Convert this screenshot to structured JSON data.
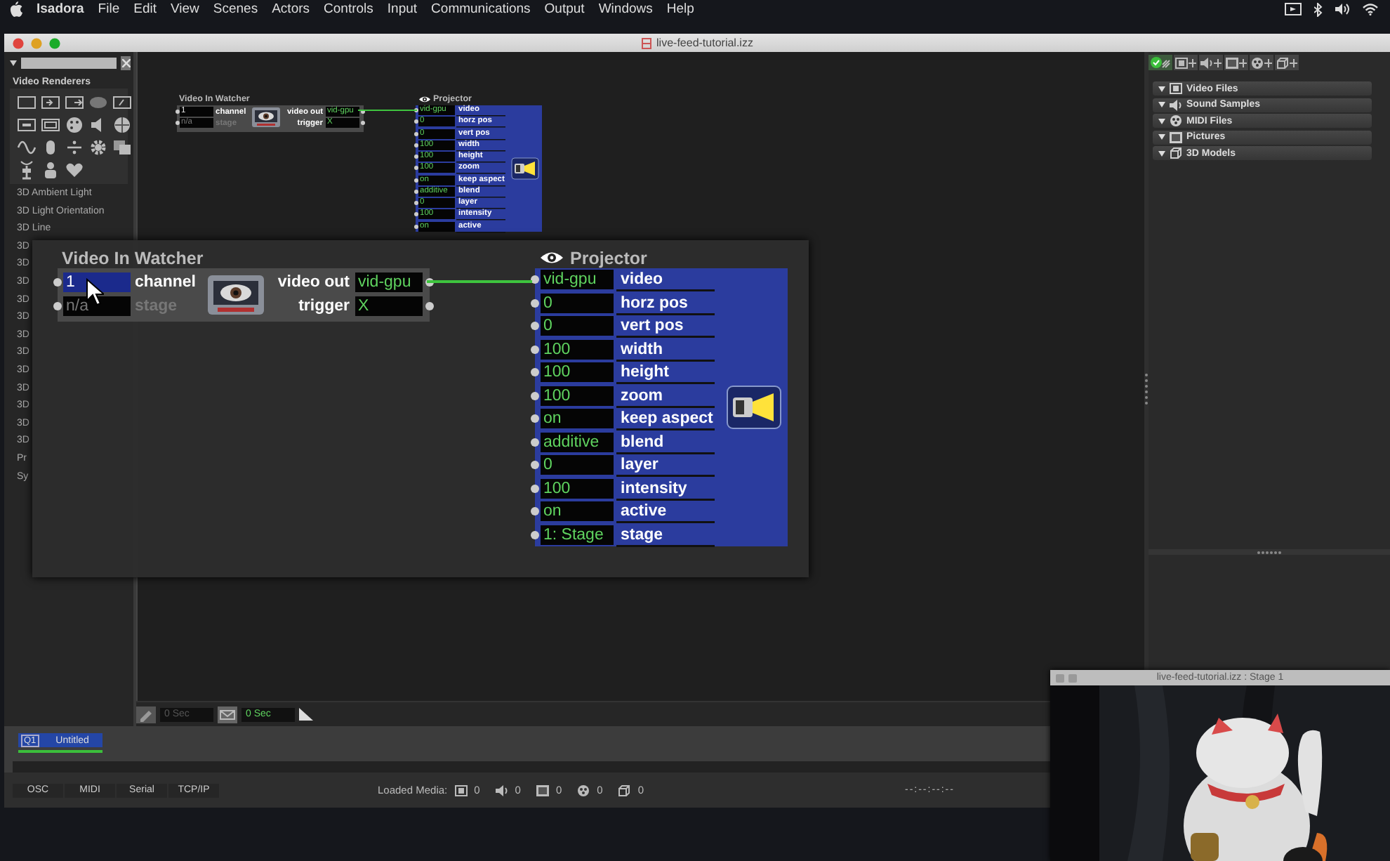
{
  "menu_bar": {
    "app": "Isadora",
    "items": [
      "File",
      "Edit",
      "View",
      "Scenes",
      "Actors",
      "Controls",
      "Input",
      "Communications",
      "Output",
      "Windows",
      "Help"
    ]
  },
  "window": {
    "title": "live-feed-tutorial.izz"
  },
  "sidebar": {
    "category": "Video Renderers",
    "items": [
      "3D Ambient Light",
      "3D Light Orientation",
      "3D Line",
      "3D",
      "3D",
      "3D",
      "3D",
      "3D",
      "3D",
      "3D",
      "3D",
      "3D",
      "3D",
      "3D",
      "3D",
      "Pr",
      "Sy"
    ]
  },
  "overview": {
    "actors": [
      {
        "kind": "watcher",
        "title": "Video In Watcher",
        "inputs": [
          {
            "value": "1",
            "label": "channel",
            "selected": false,
            "disabled": false
          },
          {
            "value": "n/a",
            "label": "stage",
            "selected": false,
            "disabled": true
          }
        ],
        "outputs": [
          {
            "label": "video out",
            "value": "vid-gpu"
          },
          {
            "label": "trigger",
            "value": "X"
          }
        ]
      },
      {
        "kind": "projector",
        "title": "Projector",
        "inputs": [
          {
            "value": "vid-gpu",
            "label": "video"
          },
          {
            "value": "0",
            "label": "horz pos"
          },
          {
            "value": "0",
            "label": "vert pos"
          },
          {
            "value": "100",
            "label": "width"
          },
          {
            "value": "100",
            "label": "height"
          },
          {
            "value": "100",
            "label": "zoom"
          },
          {
            "value": "on",
            "label": "keep aspect"
          },
          {
            "value": "additive",
            "label": "blend"
          },
          {
            "value": "0",
            "label": "layer"
          },
          {
            "value": "100",
            "label": "intensity"
          },
          {
            "value": "on",
            "label": "active"
          }
        ]
      }
    ]
  },
  "zoom_view": {
    "actors": [
      {
        "kind": "watcher",
        "title": "Video In Watcher",
        "inputs": [
          {
            "value": "1",
            "label": "channel",
            "selected": true,
            "disabled": false
          },
          {
            "value": "n/a",
            "label": "stage",
            "selected": false,
            "disabled": true
          }
        ],
        "outputs": [
          {
            "label": "video out",
            "value": "vid-gpu"
          },
          {
            "label": "trigger",
            "value": "X"
          }
        ]
      },
      {
        "kind": "projector",
        "title": "Projector",
        "inputs": [
          {
            "value": "vid-gpu",
            "label": "video"
          },
          {
            "value": "0",
            "label": "horz pos"
          },
          {
            "value": "0",
            "label": "vert pos"
          },
          {
            "value": "100",
            "label": "width"
          },
          {
            "value": "100",
            "label": "height"
          },
          {
            "value": "100",
            "label": "zoom"
          },
          {
            "value": "on",
            "label": "keep aspect"
          },
          {
            "value": "additive",
            "label": "blend"
          },
          {
            "value": "0",
            "label": "layer"
          },
          {
            "value": "100",
            "label": "intensity"
          },
          {
            "value": "on",
            "label": "active"
          },
          {
            "value": "1: Stage",
            "label": "stage"
          }
        ]
      }
    ]
  },
  "timeline": {
    "fields": [
      {
        "value": "0 Sec",
        "disabled": true
      },
      {
        "value": "0 Sec",
        "disabled": false
      }
    ]
  },
  "media_bins": [
    {
      "kind": "video",
      "label": "Video Files",
      "expanded": true
    },
    {
      "kind": "sound",
      "label": "Sound Samples",
      "expanded": true
    },
    {
      "kind": "midi",
      "label": "MIDI Files",
      "expanded": true
    },
    {
      "kind": "picture",
      "label": "Pictures",
      "expanded": true
    },
    {
      "kind": "model",
      "label": "3D Models",
      "expanded": true
    }
  ],
  "scenes": [
    {
      "number": "Q1",
      "name": "Untitled",
      "selected": true
    }
  ],
  "status_bar": {
    "buttons": [
      "OSC",
      "MIDI",
      "Serial",
      "TCP/IP"
    ],
    "loaded_media": {
      "label": "Loaded Media:",
      "counts": [
        {
          "kind": "video",
          "value": "0"
        },
        {
          "kind": "sound",
          "value": "0"
        },
        {
          "kind": "picture",
          "value": "0"
        },
        {
          "kind": "midi",
          "value": "0"
        },
        {
          "kind": "model",
          "value": "0"
        }
      ]
    },
    "timecode": "--:--:--:--"
  },
  "stage_window": {
    "title": "live-feed-tutorial.izz : Stage 1"
  }
}
